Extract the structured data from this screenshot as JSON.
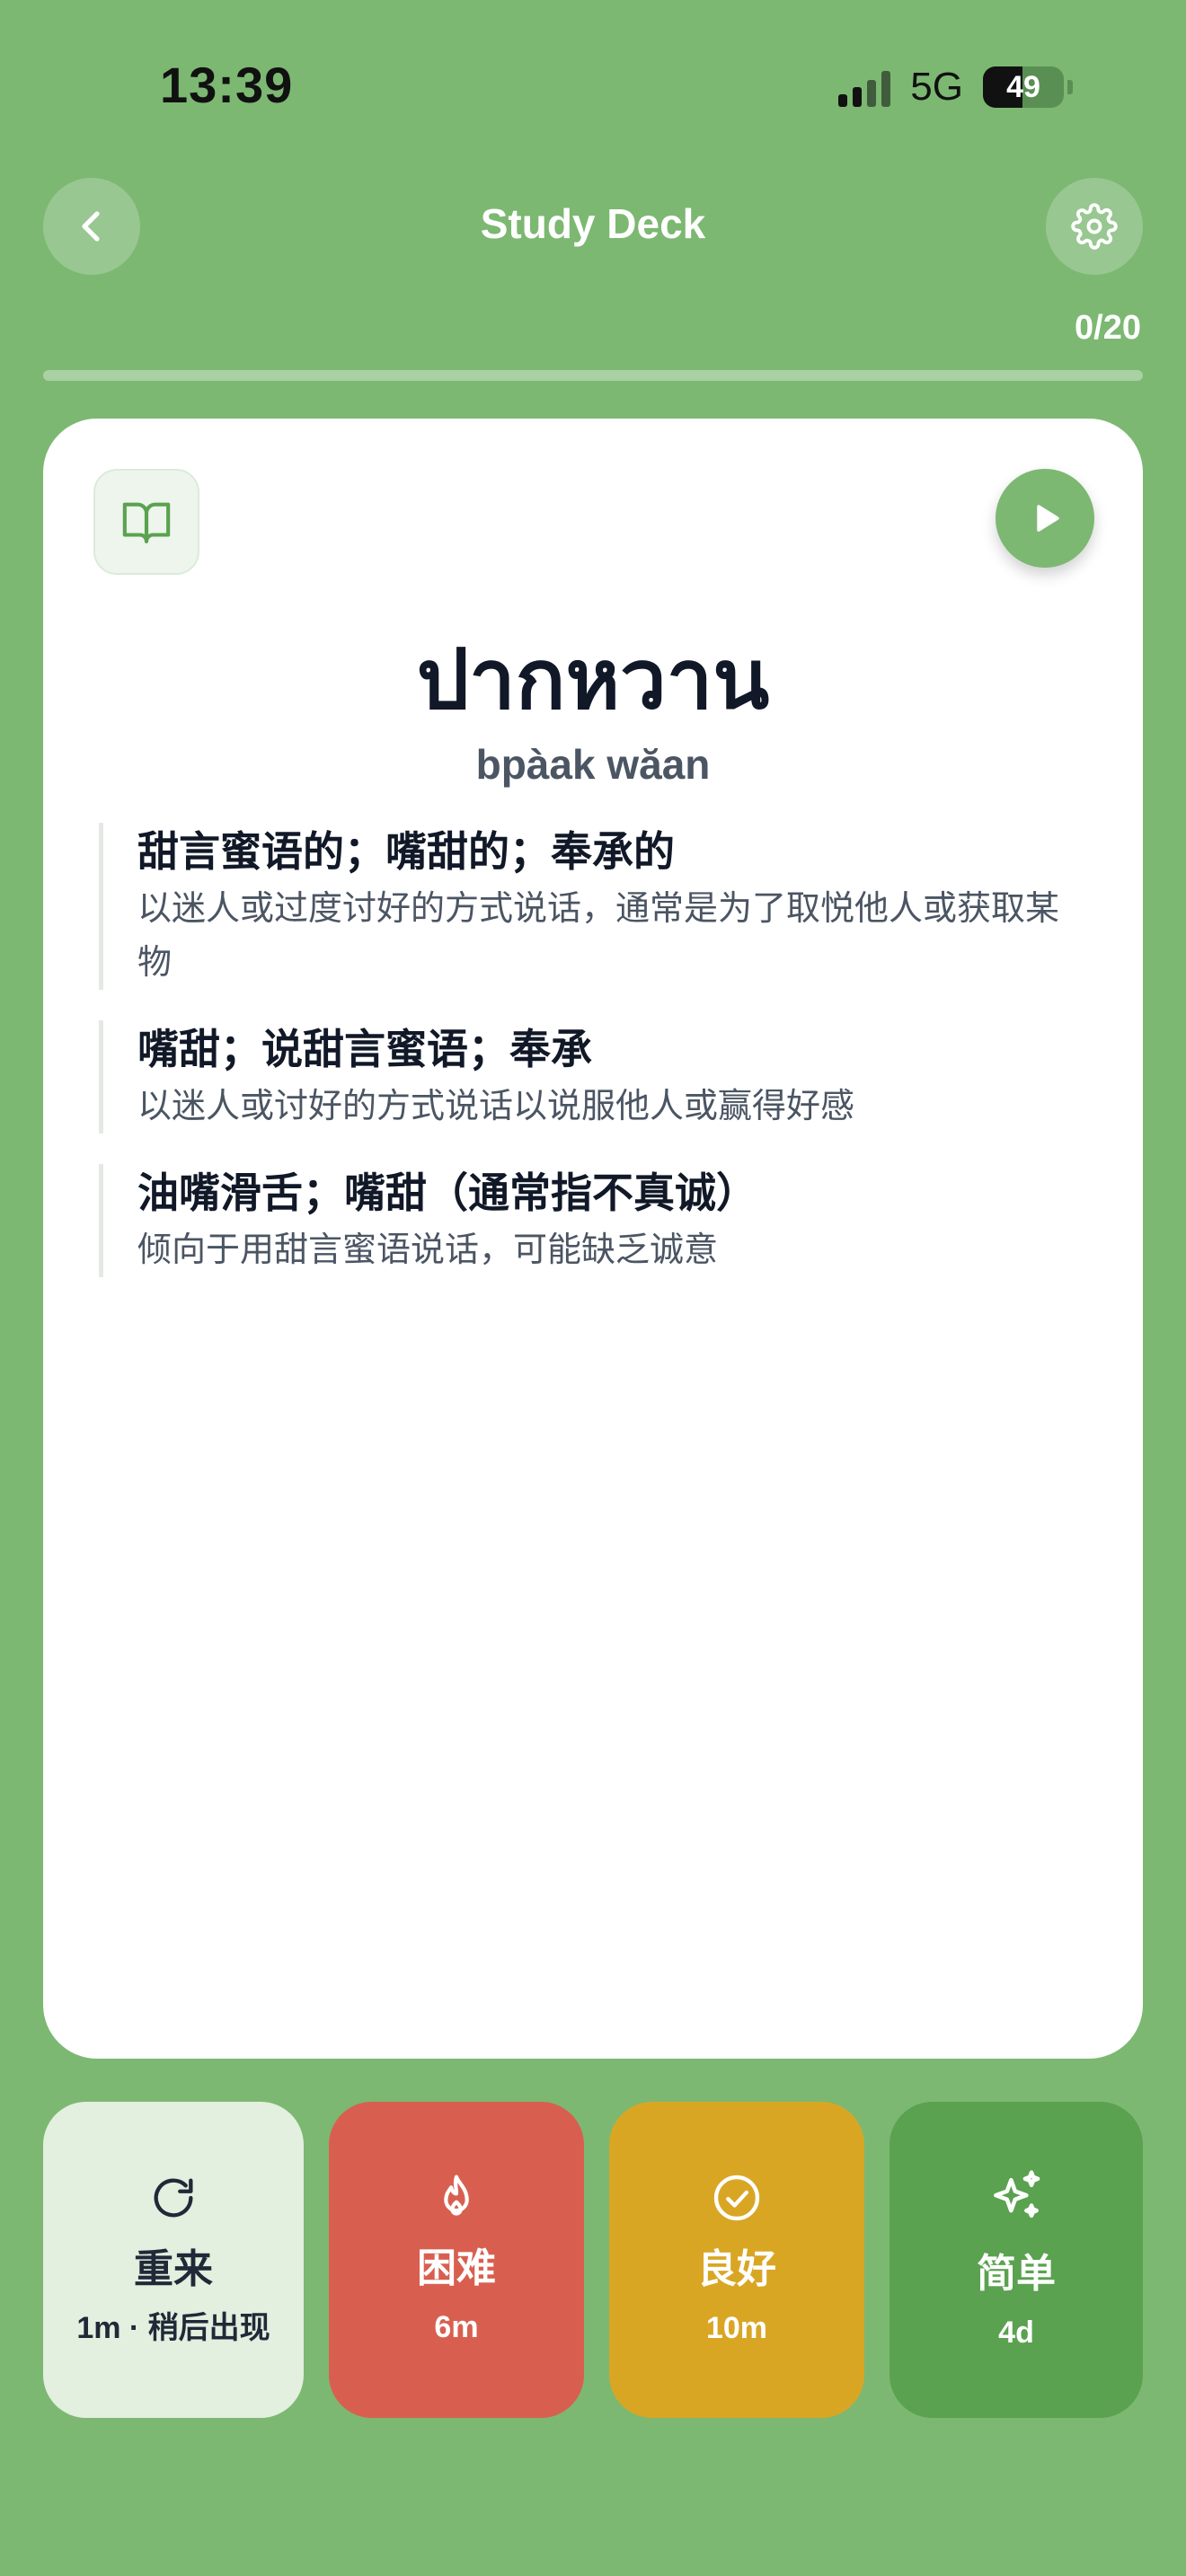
{
  "status": {
    "time": "13:39",
    "network": "5G",
    "battery": "49"
  },
  "header": {
    "title": "Study Deck",
    "progress": "0/20",
    "progress_fraction": 0
  },
  "card": {
    "word": "ปากหวาน",
    "romanization": "bpàak wăan",
    "definitions": [
      {
        "title": "甜言蜜语的；嘴甜的；奉承的",
        "desc": "以迷人或过度讨好的方式说话，通常是为了取悦他人或获取某物"
      },
      {
        "title": "嘴甜；说甜言蜜语；奉承",
        "desc": "以迷人或讨好的方式说话以说服他人或赢得好感"
      },
      {
        "title": "油嘴滑舌；嘴甜（通常指不真诚）",
        "desc": "倾向于用甜言蜜语说话，可能缺乏诚意"
      }
    ]
  },
  "answers": {
    "again": {
      "label": "重来",
      "sub": "1m · 稍后出现",
      "color": "#e3efdf"
    },
    "hard": {
      "label": "困难",
      "sub": "6m",
      "color": "#d85f4f"
    },
    "good": {
      "label": "良好",
      "sub": "10m",
      "color": "#d9a624"
    },
    "easy": {
      "label": "简单",
      "sub": "4d",
      "color": "#5aa24f"
    }
  },
  "colors": {
    "background": "#7cb872",
    "accent": "#7cb872"
  },
  "icons": [
    "chevron-left-icon",
    "gear-icon",
    "book-open-icon",
    "play-icon",
    "refresh-icon",
    "flame-icon",
    "check-circle-icon",
    "sparkles-icon"
  ]
}
